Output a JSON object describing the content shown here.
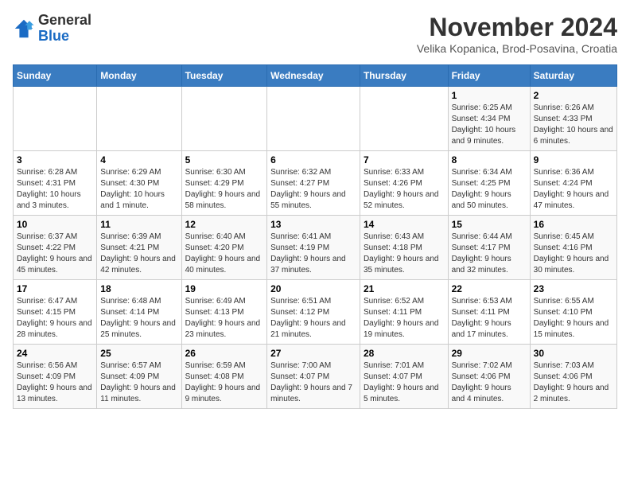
{
  "header": {
    "logo_general": "General",
    "logo_blue": "Blue",
    "month_title": "November 2024",
    "subtitle": "Velika Kopanica, Brod-Posavina, Croatia"
  },
  "weekdays": [
    "Sunday",
    "Monday",
    "Tuesday",
    "Wednesday",
    "Thursday",
    "Friday",
    "Saturday"
  ],
  "weeks": [
    [
      {
        "day": "",
        "info": ""
      },
      {
        "day": "",
        "info": ""
      },
      {
        "day": "",
        "info": ""
      },
      {
        "day": "",
        "info": ""
      },
      {
        "day": "",
        "info": ""
      },
      {
        "day": "1",
        "info": "Sunrise: 6:25 AM\nSunset: 4:34 PM\nDaylight: 10 hours and 9 minutes."
      },
      {
        "day": "2",
        "info": "Sunrise: 6:26 AM\nSunset: 4:33 PM\nDaylight: 10 hours and 6 minutes."
      }
    ],
    [
      {
        "day": "3",
        "info": "Sunrise: 6:28 AM\nSunset: 4:31 PM\nDaylight: 10 hours and 3 minutes."
      },
      {
        "day": "4",
        "info": "Sunrise: 6:29 AM\nSunset: 4:30 PM\nDaylight: 10 hours and 1 minute."
      },
      {
        "day": "5",
        "info": "Sunrise: 6:30 AM\nSunset: 4:29 PM\nDaylight: 9 hours and 58 minutes."
      },
      {
        "day": "6",
        "info": "Sunrise: 6:32 AM\nSunset: 4:27 PM\nDaylight: 9 hours and 55 minutes."
      },
      {
        "day": "7",
        "info": "Sunrise: 6:33 AM\nSunset: 4:26 PM\nDaylight: 9 hours and 52 minutes."
      },
      {
        "day": "8",
        "info": "Sunrise: 6:34 AM\nSunset: 4:25 PM\nDaylight: 9 hours and 50 minutes."
      },
      {
        "day": "9",
        "info": "Sunrise: 6:36 AM\nSunset: 4:24 PM\nDaylight: 9 hours and 47 minutes."
      }
    ],
    [
      {
        "day": "10",
        "info": "Sunrise: 6:37 AM\nSunset: 4:22 PM\nDaylight: 9 hours and 45 minutes."
      },
      {
        "day": "11",
        "info": "Sunrise: 6:39 AM\nSunset: 4:21 PM\nDaylight: 9 hours and 42 minutes."
      },
      {
        "day": "12",
        "info": "Sunrise: 6:40 AM\nSunset: 4:20 PM\nDaylight: 9 hours and 40 minutes."
      },
      {
        "day": "13",
        "info": "Sunrise: 6:41 AM\nSunset: 4:19 PM\nDaylight: 9 hours and 37 minutes."
      },
      {
        "day": "14",
        "info": "Sunrise: 6:43 AM\nSunset: 4:18 PM\nDaylight: 9 hours and 35 minutes."
      },
      {
        "day": "15",
        "info": "Sunrise: 6:44 AM\nSunset: 4:17 PM\nDaylight: 9 hours and 32 minutes."
      },
      {
        "day": "16",
        "info": "Sunrise: 6:45 AM\nSunset: 4:16 PM\nDaylight: 9 hours and 30 minutes."
      }
    ],
    [
      {
        "day": "17",
        "info": "Sunrise: 6:47 AM\nSunset: 4:15 PM\nDaylight: 9 hours and 28 minutes."
      },
      {
        "day": "18",
        "info": "Sunrise: 6:48 AM\nSunset: 4:14 PM\nDaylight: 9 hours and 25 minutes."
      },
      {
        "day": "19",
        "info": "Sunrise: 6:49 AM\nSunset: 4:13 PM\nDaylight: 9 hours and 23 minutes."
      },
      {
        "day": "20",
        "info": "Sunrise: 6:51 AM\nSunset: 4:12 PM\nDaylight: 9 hours and 21 minutes."
      },
      {
        "day": "21",
        "info": "Sunrise: 6:52 AM\nSunset: 4:11 PM\nDaylight: 9 hours and 19 minutes."
      },
      {
        "day": "22",
        "info": "Sunrise: 6:53 AM\nSunset: 4:11 PM\nDaylight: 9 hours and 17 minutes."
      },
      {
        "day": "23",
        "info": "Sunrise: 6:55 AM\nSunset: 4:10 PM\nDaylight: 9 hours and 15 minutes."
      }
    ],
    [
      {
        "day": "24",
        "info": "Sunrise: 6:56 AM\nSunset: 4:09 PM\nDaylight: 9 hours and 13 minutes."
      },
      {
        "day": "25",
        "info": "Sunrise: 6:57 AM\nSunset: 4:09 PM\nDaylight: 9 hours and 11 minutes."
      },
      {
        "day": "26",
        "info": "Sunrise: 6:59 AM\nSunset: 4:08 PM\nDaylight: 9 hours and 9 minutes."
      },
      {
        "day": "27",
        "info": "Sunrise: 7:00 AM\nSunset: 4:07 PM\nDaylight: 9 hours and 7 minutes."
      },
      {
        "day": "28",
        "info": "Sunrise: 7:01 AM\nSunset: 4:07 PM\nDaylight: 9 hours and 5 minutes."
      },
      {
        "day": "29",
        "info": "Sunrise: 7:02 AM\nSunset: 4:06 PM\nDaylight: 9 hours and 4 minutes."
      },
      {
        "day": "30",
        "info": "Sunrise: 7:03 AM\nSunset: 4:06 PM\nDaylight: 9 hours and 2 minutes."
      }
    ]
  ]
}
